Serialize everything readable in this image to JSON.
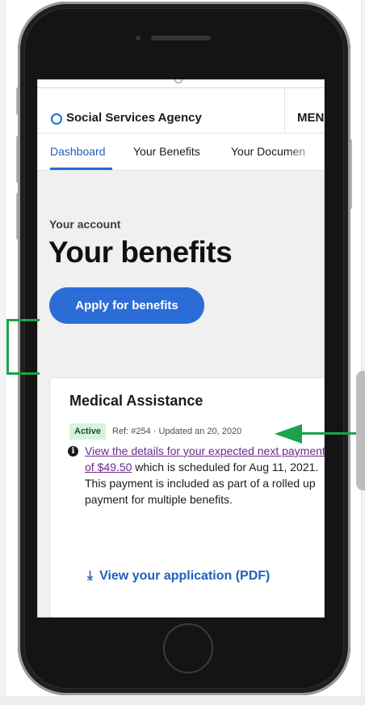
{
  "agency": {
    "name": "Social Services Agency",
    "menu_label": "MEN"
  },
  "tabs": [
    {
      "label": "Dashboard",
      "active": true
    },
    {
      "label": "Your Benefits",
      "active": false
    },
    {
      "label": "Your Documen",
      "active": false
    }
  ],
  "page": {
    "eyebrow": "Your account",
    "title": "Your benefits",
    "apply_button": "Apply for benefits"
  },
  "card": {
    "title": "Medical Assistance",
    "status_badge": "Active",
    "meta": "Ref: #254 · Updated an 20, 2020",
    "info_icon": "i",
    "info_link": "View the details for your expected next payment of $49.50",
    "info_rest": " which is scheduled for Aug 11, 2021. This payment is included as part of a rolled up payment for multiple benefits.",
    "download_label": "View your application (PDF)",
    "download_icon_glyph": "⤓"
  },
  "colors": {
    "accent": "#1f6fd1",
    "button": "#2c6cd6",
    "link_visited": "#6b2a8c",
    "badge_bg": "#d7f2dd",
    "annotation_green": "#1aa34a"
  },
  "icons": {
    "agency_logo": "circle-logo-icon",
    "info": "info-icon",
    "download": "download-icon"
  }
}
